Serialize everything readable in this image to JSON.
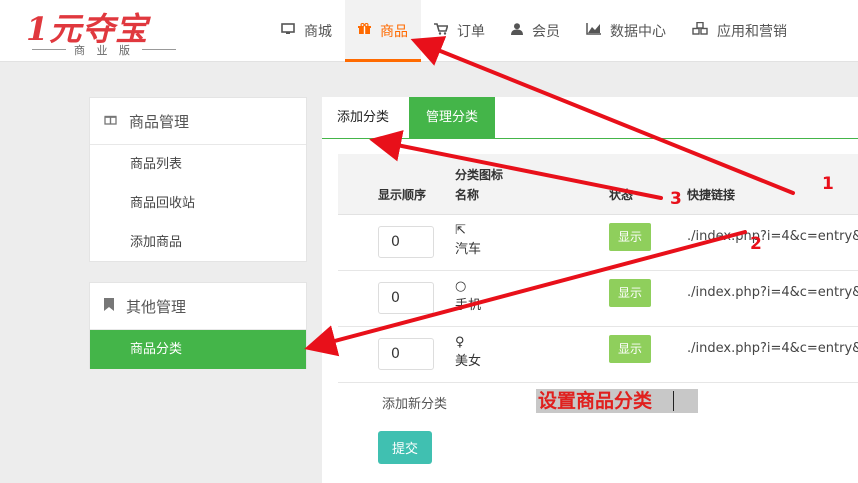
{
  "logo": {
    "main": "1元夺宝",
    "sub": "商 业 版"
  },
  "nav": [
    {
      "label": "商城",
      "icon": "monitor-icon"
    },
    {
      "label": "商品",
      "icon": "gift-icon",
      "active": true
    },
    {
      "label": "订单",
      "icon": "cart-icon"
    },
    {
      "label": "会员",
      "icon": "user-icon"
    },
    {
      "label": "数据中心",
      "icon": "chart-icon"
    },
    {
      "label": "应用和营销",
      "icon": "cubes-icon"
    }
  ],
  "sidebar": {
    "goods": {
      "title": "商品管理",
      "items": [
        "商品列表",
        "商品回收站",
        "添加商品"
      ]
    },
    "other": {
      "title": "其他管理",
      "items": [
        "商品分类"
      ]
    }
  },
  "tabs": [
    "添加分类",
    "管理分类"
  ],
  "table": {
    "headers": {
      "order": "显示顺序",
      "icon": "分类图标",
      "name": "名称",
      "status": "状态",
      "link": "快捷链接"
    },
    "rows": [
      {
        "order": "0",
        "icon_glyph": "⇱",
        "name": "汽车",
        "status": "显示",
        "link": "./index.php?i=4&c=entry&"
      },
      {
        "order": "0",
        "icon_glyph": "○",
        "name": "手机",
        "status": "显示",
        "link": "./index.php?i=4&c=entry&"
      },
      {
        "order": "0",
        "icon_glyph": "♀",
        "name": "美女",
        "status": "显示",
        "link": "./index.php?i=4&c=entry&"
      }
    ],
    "add_new": "添加新分类",
    "submit": "提交"
  },
  "annotation": {
    "label": "设置商品分类",
    "numbers": [
      "1",
      "2",
      "3"
    ],
    "color": "#e8101a"
  },
  "colors": {
    "accent_orange": "#ff6a00",
    "green": "#44b549",
    "badge_green": "#8fcf5c",
    "teal": "#40c0b1"
  }
}
